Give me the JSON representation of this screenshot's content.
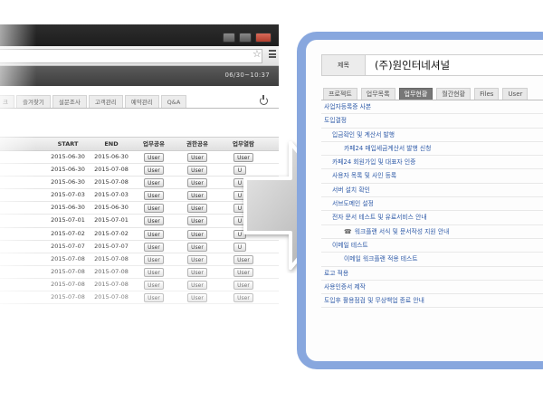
{
  "left_window": {
    "clock": "06/30~10:37",
    "tabs": [
      {
        "label": "크"
      },
      {
        "label": "즐겨찾기"
      },
      {
        "label": "설문조사"
      },
      {
        "label": "고객관리"
      },
      {
        "label": "예약관리"
      },
      {
        "label": "Q&A"
      }
    ],
    "columns": [
      "START",
      "END",
      "업무공유",
      "권한공유",
      "업무열람"
    ],
    "rows": [
      {
        "start": "2015-06-30",
        "end": "2015-06-30",
        "b1": "User",
        "b2": "User",
        "b3": "User"
      },
      {
        "start": "2015-06-30",
        "end": "2015-07-08",
        "b1": "User",
        "b2": "User",
        "b3": "U"
      },
      {
        "start": "2015-06-30",
        "end": "2015-07-08",
        "b1": "User",
        "b2": "User",
        "b3": "U"
      },
      {
        "start": "2015-07-03",
        "end": "2015-07-03",
        "b1": "User",
        "b2": "User",
        "b3": "U"
      },
      {
        "start": "2015-06-30",
        "end": "2015-06-30",
        "b1": "User",
        "b2": "User",
        "b3": "U"
      },
      {
        "start": "2015-07-01",
        "end": "2015-07-01",
        "b1": "User",
        "b2": "User",
        "b3": "U"
      },
      {
        "start": "2015-07-02",
        "end": "2015-07-02",
        "b1": "User",
        "b2": "User",
        "b3": "U"
      },
      {
        "start": "2015-07-07",
        "end": "2015-07-07",
        "b1": "User",
        "b2": "User",
        "b3": "U"
      },
      {
        "start": "2015-07-08",
        "end": "2015-07-08",
        "b1": "User",
        "b2": "User",
        "b3": "User"
      },
      {
        "start": "2015-07-08",
        "end": "2015-07-08",
        "b1": "User",
        "b2": "User",
        "b3": "User"
      },
      {
        "start": "2015-07-08",
        "end": "2015-07-08",
        "b1": "User",
        "b2": "User",
        "b3": "User"
      },
      {
        "start": "2015-07-08",
        "end": "2015-07-08",
        "b1": "User",
        "b2": "User",
        "b3": "User"
      }
    ]
  },
  "right_panel": {
    "title_label": "제목",
    "title_value": "(주)원인터네셔널",
    "tabs": [
      {
        "label": "프로젝트",
        "active": false
      },
      {
        "label": "업무목록",
        "active": false
      },
      {
        "label": "업무현황",
        "active": true
      },
      {
        "label": "월간현황",
        "active": false
      },
      {
        "label": "Files",
        "active": false
      },
      {
        "label": "User",
        "active": false
      }
    ],
    "tasks": [
      {
        "label": "사업자등록증 사본",
        "level": 0,
        "icon": ""
      },
      {
        "label": "도입결정",
        "level": 0,
        "icon": ""
      },
      {
        "label": "입금확인 및 계산서 발행",
        "level": 1,
        "icon": ""
      },
      {
        "label": "카페24 매입세금계산서 발행 신청",
        "level": 2,
        "icon": ""
      },
      {
        "label": "카페24 회원가입 및 대표자 인증",
        "level": 1,
        "icon": ""
      },
      {
        "label": "사용자 목록 및 사인 등록",
        "level": 1,
        "icon": ""
      },
      {
        "label": "서버 설치 확인",
        "level": 1,
        "icon": ""
      },
      {
        "label": "서브도메인 설정",
        "level": 1,
        "icon": ""
      },
      {
        "label": "전자 문서 테스트 및 유료서비스 안내",
        "level": 1,
        "icon": ""
      },
      {
        "label": "워크플랜 서식 및 문서작성 지원 안내",
        "level": 2,
        "icon": "phone-icon"
      },
      {
        "label": "이메일 테스트",
        "level": 1,
        "icon": ""
      },
      {
        "label": "이메일 워크플랜 적용 테스트",
        "level": 2,
        "icon": ""
      },
      {
        "label": "로고 적용",
        "level": 0,
        "icon": ""
      },
      {
        "label": "사용인증서 제작",
        "level": 0,
        "icon": ""
      },
      {
        "label": "도입후 활용점검 및 무상백업 종료 안내",
        "level": 0,
        "icon": ""
      }
    ]
  },
  "colors": {
    "panel_frame": "#88a7de",
    "link_text": "#2e5aa8",
    "active_tab": "#777777"
  }
}
